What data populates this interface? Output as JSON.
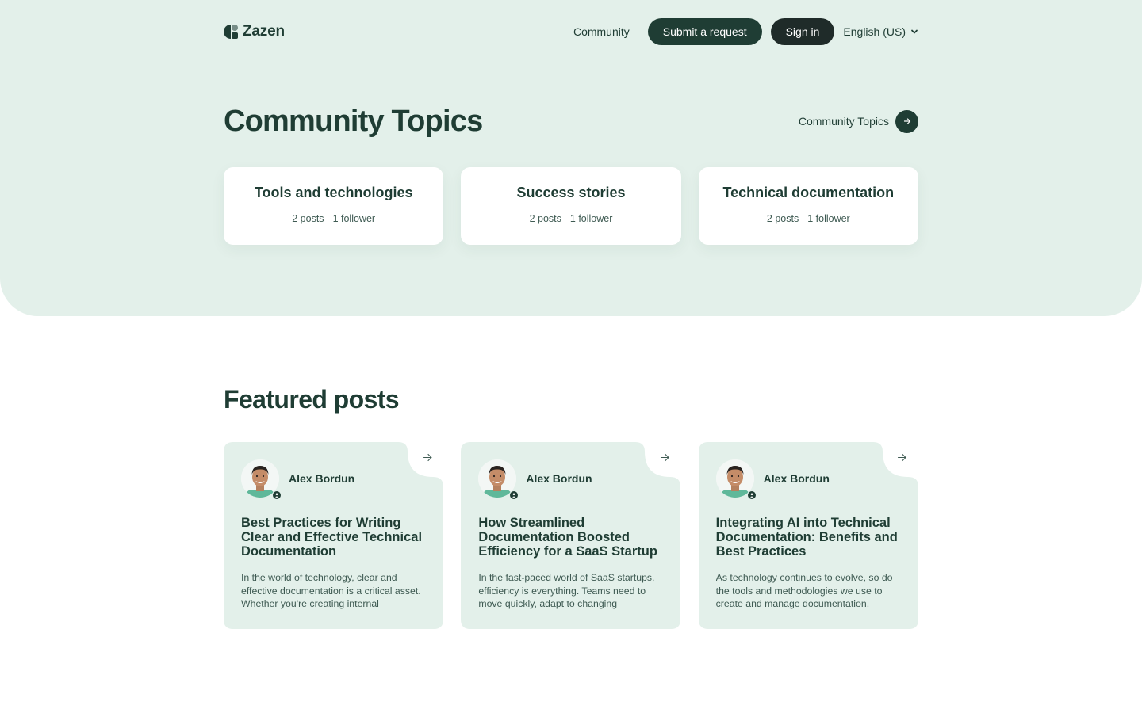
{
  "header": {
    "brand": "Zazen",
    "nav": {
      "community": "Community",
      "submit_request": "Submit a request",
      "sign_in": "Sign in",
      "language": "English (US)"
    }
  },
  "community": {
    "title": "Community Topics",
    "see_all_label": "Community Topics",
    "topics": [
      {
        "title": "Tools and technologies",
        "posts": "2 posts",
        "followers": "1 follower"
      },
      {
        "title": "Success stories",
        "posts": "2 posts",
        "followers": "1 follower"
      },
      {
        "title": "Technical documentation",
        "posts": "2 posts",
        "followers": "1 follower"
      }
    ]
  },
  "featured": {
    "title": "Featured posts",
    "posts": [
      {
        "author": "Alex Bordun",
        "title": "Best Practices for Writing Clear and Effective Technical Documentation",
        "excerpt": "In the world of technology, clear and effective documentation is a critical asset. Whether you're creating internal"
      },
      {
        "author": "Alex Bordun",
        "title": "How Streamlined Documentation Boosted Efficiency for a SaaS Startup",
        "excerpt": "In the fast-paced world of SaaS startups, efficiency is everything. Teams need to move quickly, adapt to changing"
      },
      {
        "author": "Alex Bordun",
        "title": "Integrating AI into Technical Documentation: Benefits and Best Practices",
        "excerpt": "As technology continues to evolve, so do the tools and methodologies we use to create and manage documentation."
      }
    ]
  },
  "colors": {
    "hero_bg": "#e3f0ea",
    "primary": "#1f3d34",
    "sign_in_bg": "#1f2b29",
    "card_bg": "#ffffff",
    "post_card_bg": "#e3f0ea"
  },
  "icons": {
    "logo": "zazen-logo-icon",
    "language_toggle": "chevron-down-icon",
    "see_all": "arrow-right-icon",
    "post_link": "arrow-right-icon",
    "author_badge": "user-badge-icon"
  }
}
